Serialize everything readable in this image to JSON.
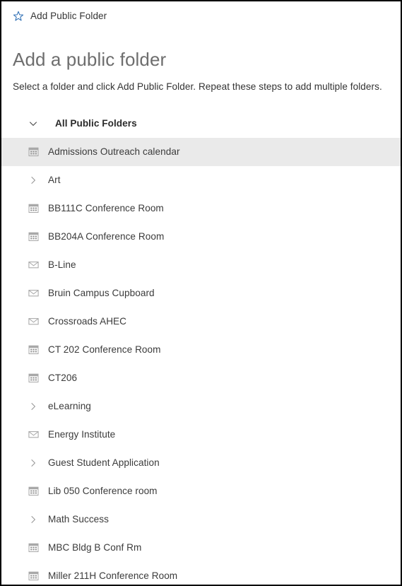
{
  "window": {
    "background": "#ffffff",
    "border_color": "#000000"
  },
  "command_bar": {
    "star_icon": "star-outline-icon",
    "star_icon_color": "#2f6fb5",
    "add_public_folder_label": "Add Public Folder"
  },
  "page": {
    "title": "Add a public folder",
    "title_color": "#6e6e6e",
    "subtitle": "Select a folder and click Add Public Folder. Repeat these steps to add multiple folders."
  },
  "tree": {
    "root": {
      "label": "All Public Folders",
      "twisty": "chevron-down-icon",
      "expanded": true
    },
    "selection_color": "#eaeaea",
    "items": [
      {
        "label": "Admissions Outreach calendar",
        "icon": "calendar-icon",
        "selected": true
      },
      {
        "label": "Art",
        "icon": "chevron-right-icon",
        "selected": false
      },
      {
        "label": "BB111C Conference Room",
        "icon": "calendar-icon",
        "selected": false
      },
      {
        "label": "BB204A Conference Room",
        "icon": "calendar-icon",
        "selected": false
      },
      {
        "label": "B-Line",
        "icon": "envelope-icon",
        "selected": false
      },
      {
        "label": "Bruin Campus Cupboard",
        "icon": "envelope-icon",
        "selected": false
      },
      {
        "label": "Crossroads AHEC",
        "icon": "envelope-icon",
        "selected": false
      },
      {
        "label": "CT 202 Conference Room",
        "icon": "calendar-icon",
        "selected": false
      },
      {
        "label": "CT206",
        "icon": "calendar-icon",
        "selected": false
      },
      {
        "label": "eLearning",
        "icon": "chevron-right-icon",
        "selected": false
      },
      {
        "label": "Energy Institute",
        "icon": "envelope-icon",
        "selected": false
      },
      {
        "label": "Guest Student Application",
        "icon": "chevron-right-icon",
        "selected": false
      },
      {
        "label": "Lib 050 Conference room",
        "icon": "calendar-icon",
        "selected": false
      },
      {
        "label": "Math Success",
        "icon": "chevron-right-icon",
        "selected": false
      },
      {
        "label": "MBC Bldg B Conf Rm",
        "icon": "calendar-icon",
        "selected": false
      },
      {
        "label": "Miller 211H Conference Room",
        "icon": "calendar-icon",
        "selected": false
      }
    ]
  }
}
